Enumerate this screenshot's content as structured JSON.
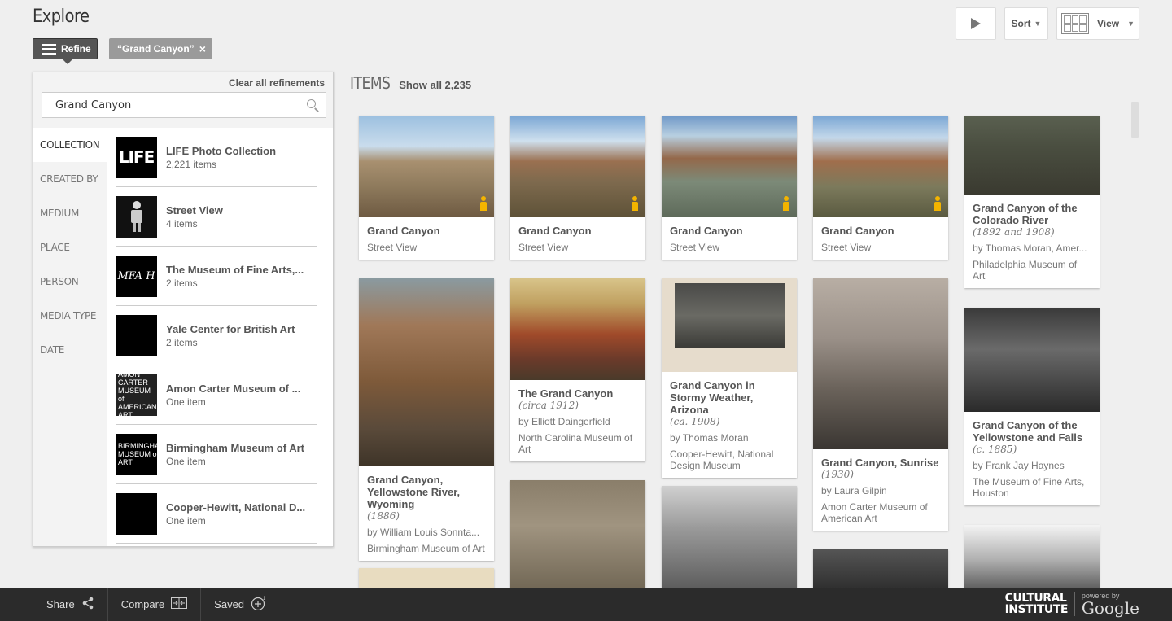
{
  "header": {
    "title": "Explore",
    "refine_label": "Refine",
    "chip_label": "“Grand Canyon”",
    "chip_close": "×",
    "sort_label": "Sort",
    "view_label": "View"
  },
  "refine": {
    "clear_label": "Clear all refinements",
    "search_value": "Grand Canyon",
    "facets": [
      "COLLECTION",
      "CREATED BY",
      "MEDIUM",
      "PLACE",
      "PERSON",
      "MEDIA TYPE",
      "DATE"
    ],
    "collections": [
      {
        "name": "LIFE Photo Collection",
        "count": "2,221 items",
        "thumb": "LIFE"
      },
      {
        "name": "Street View",
        "count": "4 items",
        "thumb": ""
      },
      {
        "name": "The Museum of Fine Arts,...",
        "count": "2 items",
        "thumb": "MFA H"
      },
      {
        "name": "Yale Center for British Art",
        "count": "2 items",
        "thumb": ""
      },
      {
        "name": "Amon Carter Museum of ...",
        "count": "One item",
        "thumb": "AMON CARTER MUSEUM of AMERICAN ART"
      },
      {
        "name": "Birmingham Museum of Art",
        "count": "One item",
        "thumb": "BIRMINGHAM MUSEUM of ART"
      },
      {
        "name": "Cooper-Hewitt, National D...",
        "count": "One item",
        "thumb": ""
      }
    ]
  },
  "items": {
    "label": "ITEMS",
    "show_all": "Show all 2,235",
    "cards": [
      {
        "title": "Grand Canyon",
        "date": "",
        "author": "",
        "source": "Street View"
      },
      {
        "title": "Grand Canyon",
        "date": "",
        "author": "",
        "source": "Street View"
      },
      {
        "title": "Grand Canyon",
        "date": "",
        "author": "",
        "source": "Street View"
      },
      {
        "title": "Grand Canyon",
        "date": "",
        "author": "",
        "source": "Street View"
      },
      {
        "title": "Grand Canyon of the Colorado River",
        "date": "(1892 and 1908)",
        "author": "by Thomas Moran, Amer...",
        "source": "Philadelphia Museum of Art"
      },
      {
        "title": "Grand Canyon, Yellowstone River, Wyoming",
        "date": "(1886)",
        "author": "by William Louis Sonntа...",
        "source": "Birmingham Museum of Art"
      },
      {
        "title": "The Grand Canyon",
        "date": "(circa 1912)",
        "author": "by Elliott Daingerfield",
        "source": "North Carolina Museum of Art"
      },
      {
        "title": "Grand Canyon in Stormy Weather, Arizona",
        "date": "(ca. 1908)",
        "author": "by Thomas Moran",
        "source": "Cooper-Hewitt, National Design Museum"
      },
      {
        "title": "Grand Canyon, Sunrise",
        "date": "(1930)",
        "author": "by Laura Gilpin",
        "source": "Amon Carter Museum of American Art"
      },
      {
        "title": "Grand Canyon of the Yellowstone and Falls",
        "date": "(c. 1885)",
        "author": "by Frank Jay Haynes",
        "source": "The Museum of Fine Arts, Houston"
      }
    ]
  },
  "footer": {
    "share": "Share",
    "compare": "Compare",
    "saved": "Saved",
    "powered_by": "powered by",
    "brand_line1": "CULTURAL",
    "brand_line2": "INSTITUTE",
    "google": "Google"
  }
}
